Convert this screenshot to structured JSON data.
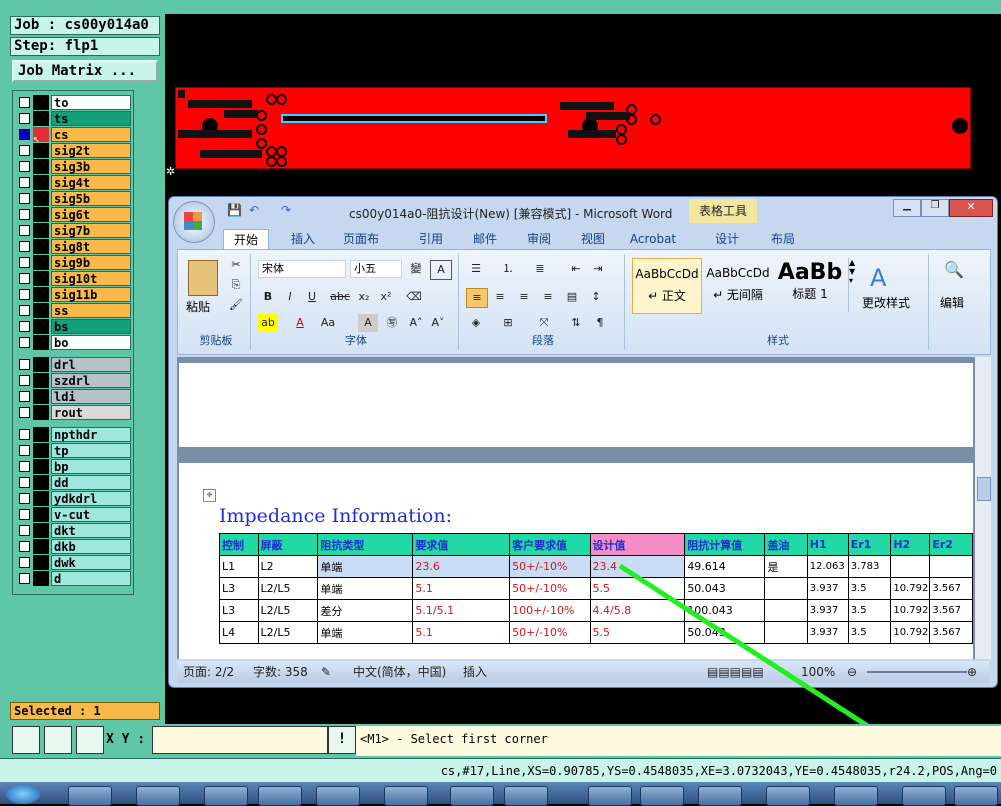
{
  "job": {
    "name": "Job : cs00y014a0",
    "step": "Step: flp1",
    "matrix_button": "Job Matrix ..."
  },
  "layers": [
    {
      "name": "to",
      "color": "#ffffff"
    },
    {
      "name": "ts",
      "color": "#16a07a"
    },
    {
      "name": "cs",
      "color": "#f7b94a",
      "active": true
    },
    {
      "name": "sig2t",
      "color": "#f7b94a"
    },
    {
      "name": "sig3b",
      "color": "#f7b94a"
    },
    {
      "name": "sig4t",
      "color": "#f7b94a"
    },
    {
      "name": "sig5b",
      "color": "#f7b94a"
    },
    {
      "name": "sig6t",
      "color": "#f7b94a"
    },
    {
      "name": "sig7b",
      "color": "#f7b94a"
    },
    {
      "name": "sig8t",
      "color": "#f7b94a"
    },
    {
      "name": "sig9b",
      "color": "#f7b94a"
    },
    {
      "name": "sig10t",
      "color": "#f7b94a"
    },
    {
      "name": "sig11b",
      "color": "#f7b94a"
    },
    {
      "name": "ss",
      "color": "#f7b94a"
    },
    {
      "name": "bs",
      "color": "#16a07a"
    },
    {
      "name": "bo",
      "color": "#ffffff"
    }
  ],
  "drill_layers": [
    {
      "name": "drl",
      "color": "#b5c3c8"
    },
    {
      "name": "szdrl",
      "color": "#b5c3c8"
    },
    {
      "name": "ldi",
      "color": "#b5c3c8"
    },
    {
      "name": "rout",
      "color": "#d9d9d9"
    }
  ],
  "other_layers": [
    {
      "name": "npthdr",
      "color": "#9ee7df"
    },
    {
      "name": "tp",
      "color": "#9ee7df"
    },
    {
      "name": "bp",
      "color": "#9ee7df"
    },
    {
      "name": "dd",
      "color": "#9ee7df"
    },
    {
      "name": "ydkdrl",
      "color": "#9ee7df"
    },
    {
      "name": "v-cut",
      "color": "#9ee7df"
    },
    {
      "name": "dkt",
      "color": "#9ee7df"
    },
    {
      "name": "dkb",
      "color": "#9ee7df"
    },
    {
      "name": "dwk",
      "color": "#9ee7df"
    },
    {
      "name": "d",
      "color": "#9ee7df"
    }
  ],
  "selected": "Selected : 1",
  "command": {
    "xy_label": "X Y :",
    "xy_value": "",
    "prompt": "<M1> - Select first corner",
    "bang": "!"
  },
  "status": "cs,#17,Line,XS=0.90785,YS=0.4548035,XE=3.0732043,YE=0.4548035,r24.2,POS,Ang=0",
  "word": {
    "title": "cs00y014a0-阻抗设计(New) [兼容模式] - Microsoft Word",
    "context_tab": "表格工具",
    "tabs": [
      "开始",
      "插入",
      "页面布局",
      "引用",
      "邮件",
      "审阅",
      "视图",
      "Acrobat",
      "设计",
      "布局"
    ],
    "ribbon": {
      "paste": "粘贴",
      "clipboard": "剪贴板",
      "font_name": "宋体",
      "font_size": "小五",
      "font_group": "字体",
      "para_group": "段落",
      "styles": [
        {
          "sample": "AaBbCcDd",
          "name": "↵ 正文"
        },
        {
          "sample": "AaBbCcDd",
          "name": "↵ 无间隔"
        },
        {
          "sample": "AaBb",
          "name": "标题 1"
        }
      ],
      "change_styles": "更改样式",
      "styles_group": "样式",
      "edit": "编辑"
    },
    "doc": {
      "heading": "Impedance Information:",
      "headers": [
        "控制",
        "屏蔽",
        "阻抗类型",
        "要求值",
        "客户要求值",
        "设计值",
        "阻抗计算值",
        "盖油",
        "H1",
        "Er1",
        "H2",
        "Er2"
      ],
      "rows": [
        [
          "L1",
          "L2",
          "单端",
          "23.6",
          "50+/-10%",
          "23.4",
          "49.614",
          "是",
          "12.063",
          "3.783",
          "",
          ""
        ],
        [
          "L3",
          "L2/L5",
          "单端",
          "5.1",
          "50+/-10%",
          "5.5",
          "50.043",
          "",
          "3.937",
          "3.5",
          "10.792",
          "3.567"
        ],
        [
          "L3",
          "L2/L5",
          "差分",
          "5.1/5.1",
          "100+/-10%",
          "4.4/5.8",
          "100.043",
          "",
          "3.937",
          "3.5",
          "10.792",
          "3.567"
        ],
        [
          "L4",
          "L2/L5",
          "单端",
          "5.1",
          "50+/-10%",
          "5.5",
          "50.043",
          "",
          "3.937",
          "3.5",
          "10.792",
          "3.567"
        ]
      ]
    },
    "statusbar": {
      "page": "页面: 2/2",
      "words": "字数: 358",
      "lang": "中文(简体，中国)",
      "mode": "插入",
      "zoom": "100%"
    }
  },
  "colors": {
    "panel": "#5fc7a8",
    "pcb": "#ff0000",
    "arrow": "#22ee22"
  }
}
